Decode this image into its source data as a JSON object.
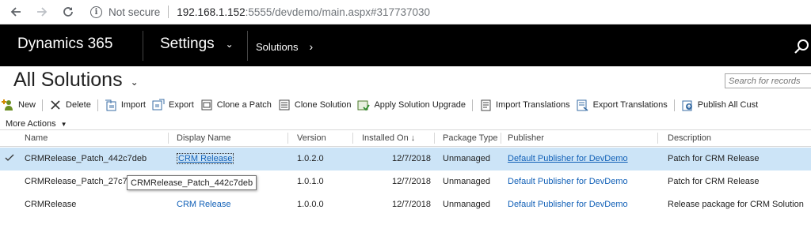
{
  "browser": {
    "security": "Not secure",
    "url_host": "192.168.1.152",
    "url_rest": ":5555/devdemo/main.aspx#317737030"
  },
  "app": {
    "brand": "Dynamics 365",
    "area": "Settings",
    "breadcrumb": "Solutions"
  },
  "page": {
    "title": "All Solutions",
    "search_placeholder": "Search for records"
  },
  "toolbar": {
    "new": "New",
    "delete": "Delete",
    "import": "Import",
    "export": "Export",
    "clone_patch": "Clone a Patch",
    "clone_solution": "Clone Solution",
    "apply_upgrade": "Apply Solution Upgrade",
    "import_translations": "Import Translations",
    "export_translations": "Export Translations",
    "publish_all": "Publish All Cust"
  },
  "more_actions": "More Actions",
  "grid": {
    "columns": {
      "name": "Name",
      "display_name": "Display Name",
      "version": "Version",
      "installed_on": "Installed On",
      "package_type": "Package Type",
      "publisher": "Publisher",
      "description": "Description"
    },
    "rows": [
      {
        "name": "CRMRelease_Patch_442c7deb",
        "display_name": "CRM Release",
        "version": "1.0.2.0",
        "installed_on": "12/7/2018",
        "package_type": "Unmanaged",
        "publisher": "Default Publisher for DevDemo",
        "description": "Patch for CRM Release"
      },
      {
        "name": "CRMRelease_Patch_27c73c",
        "display_name": "",
        "version": "1.0.1.0",
        "installed_on": "12/7/2018",
        "package_type": "Unmanaged",
        "publisher": "Default Publisher for DevDemo",
        "description": "Patch for CRM Release"
      },
      {
        "name": "CRMRelease",
        "display_name": "CRM Release",
        "version": "1.0.0.0",
        "installed_on": "12/7/2018",
        "package_type": "Unmanaged",
        "publisher": "Default Publisher for DevDemo",
        "description": "Release package for CRM Solution"
      }
    ]
  },
  "tooltip": "CRMRelease_Patch_442c7deb",
  "colors": {
    "appbar": "#000000",
    "selected_row": "#cce4f7",
    "link": "#1160b7"
  }
}
